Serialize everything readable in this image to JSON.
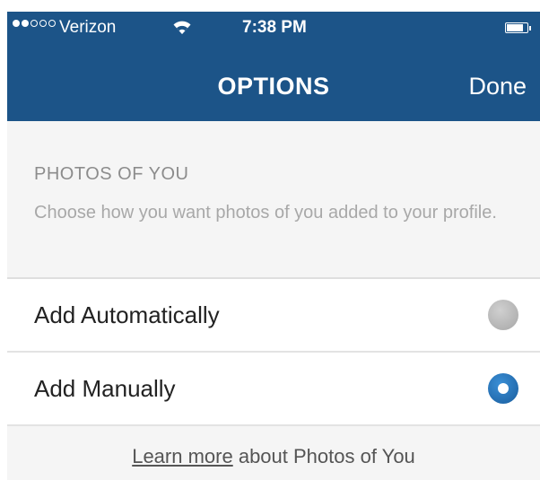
{
  "status_bar": {
    "carrier": "Verizon",
    "time": "7:38 PM",
    "signal_bars_filled": 2,
    "signal_bars_total": 5,
    "wifi_icon": "wifi-icon",
    "battery_icon": "battery-icon"
  },
  "nav": {
    "title": "OPTIONS",
    "done_label": "Done"
  },
  "section": {
    "header": "PHOTOS OF YOU",
    "description": "Choose how you want photos of you added to your profile."
  },
  "options": [
    {
      "label": "Add Automatically",
      "selected": false
    },
    {
      "label": "Add Manually",
      "selected": true
    }
  ],
  "footer": {
    "link_text": "Learn more",
    "rest_text": " about Photos of You"
  },
  "colors": {
    "header_bg": "#1c5488",
    "radio_selected": "#2a78c2",
    "radio_unselected": "#b5b5b5"
  }
}
